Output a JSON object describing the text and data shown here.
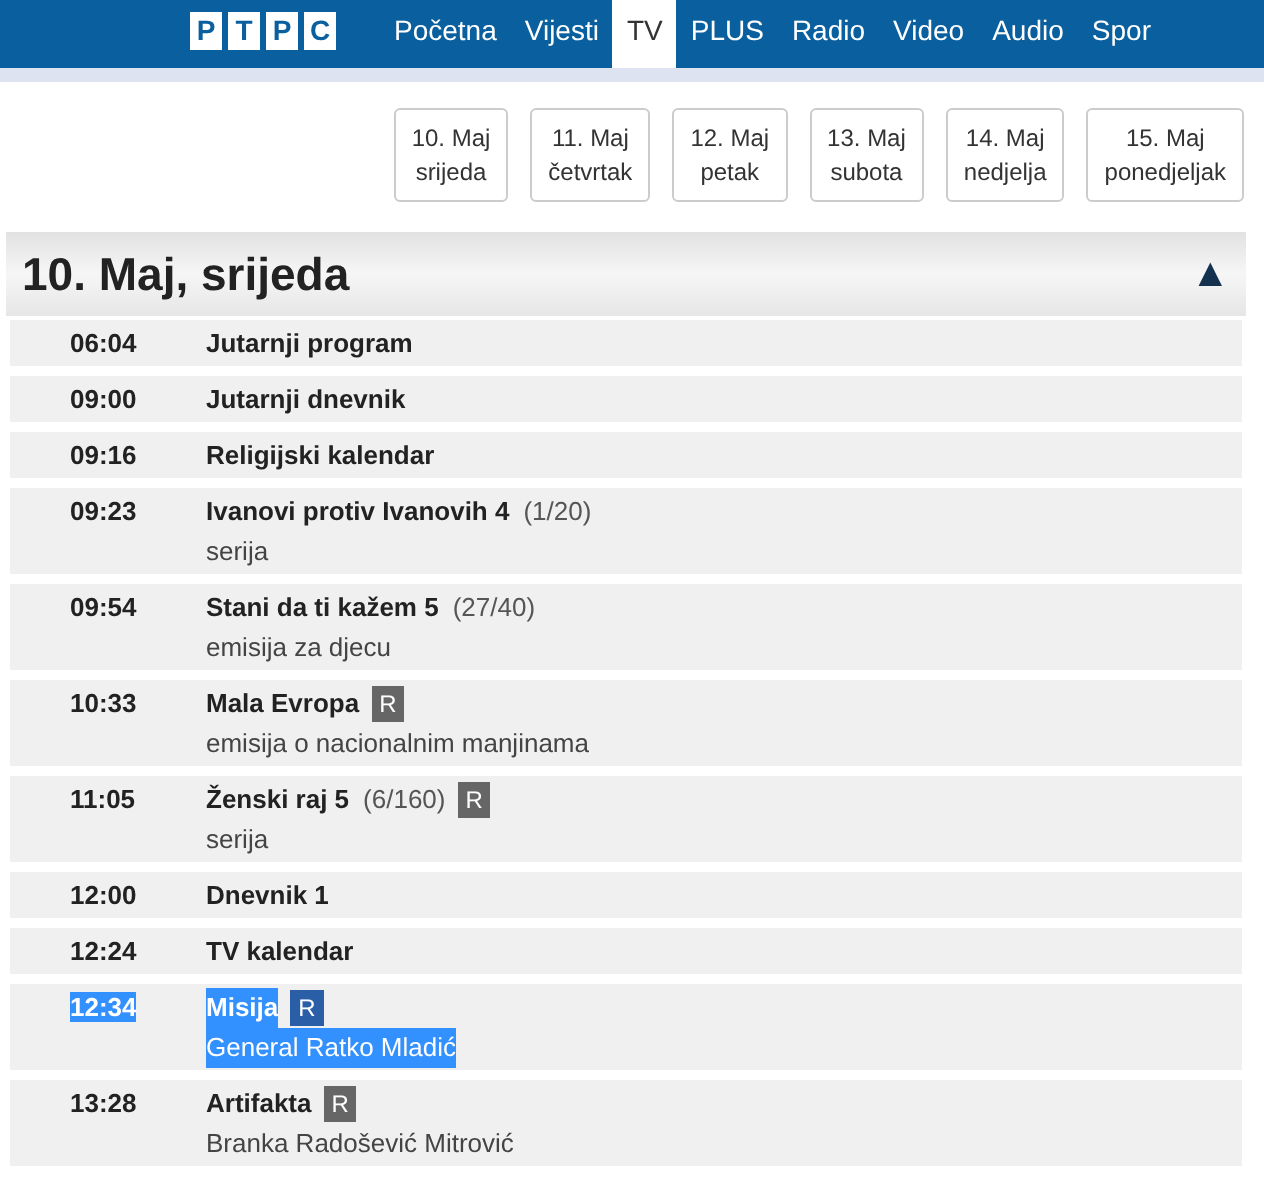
{
  "logo": {
    "letters": [
      "P",
      "T",
      "P",
      "C"
    ]
  },
  "nav": [
    {
      "label": "Početna",
      "selected": false
    },
    {
      "label": "Vijesti",
      "selected": false
    },
    {
      "label": "TV",
      "selected": true
    },
    {
      "label": "PLUS",
      "selected": false
    },
    {
      "label": "Radio",
      "selected": false
    },
    {
      "label": "Video",
      "selected": false
    },
    {
      "label": "Audio",
      "selected": false
    },
    {
      "label": "Spor",
      "selected": false
    }
  ],
  "days": [
    {
      "date": "10. Maj",
      "weekday": "srijeda"
    },
    {
      "date": "11. Maj",
      "weekday": "četvrtak"
    },
    {
      "date": "12. Maj",
      "weekday": "petak"
    },
    {
      "date": "13. Maj",
      "weekday": "subota"
    },
    {
      "date": "14. Maj",
      "weekday": "nedjelja"
    },
    {
      "date": "15. Maj",
      "weekday": "ponedjeljak"
    }
  ],
  "schedule": {
    "title": "10. Maj, srijeda",
    "toggle": "▲",
    "rows": [
      {
        "time": "06:04",
        "title": "Jutarnji program",
        "highlighted": false
      },
      {
        "time": "09:00",
        "title": "Jutarnji dnevnik",
        "highlighted": false
      },
      {
        "time": "09:16",
        "title": "Religijski kalendar",
        "highlighted": false
      },
      {
        "time": "09:23",
        "title": "Ivanovi protiv Ivanovih 4",
        "episode": "(1/20)",
        "subtitle": "serija",
        "highlighted": false
      },
      {
        "time": "09:54",
        "title": "Stani da ti kažem 5",
        "episode": "(27/40)",
        "subtitle": "emisija za djecu",
        "highlighted": false
      },
      {
        "time": "10:33",
        "title": "Mala Evropa",
        "badge": "R",
        "subtitle": "emisija o nacionalnim manjinama",
        "highlighted": false
      },
      {
        "time": "11:05",
        "title": "Ženski raj 5",
        "episode": "(6/160)",
        "badge": "R",
        "subtitle": "serija",
        "highlighted": false
      },
      {
        "time": "12:00",
        "title": "Dnevnik 1",
        "highlighted": false
      },
      {
        "time": "12:24",
        "title": "TV kalendar",
        "highlighted": false
      },
      {
        "time": "12:34",
        "title": "Misija",
        "badge": "R",
        "subtitle": "General Ratko Mladić",
        "highlighted": true
      },
      {
        "time": "13:28",
        "title": "Artifakta",
        "badge": "R",
        "subtitle": "Branka Radošević Mitrović",
        "highlighted": false
      }
    ]
  }
}
